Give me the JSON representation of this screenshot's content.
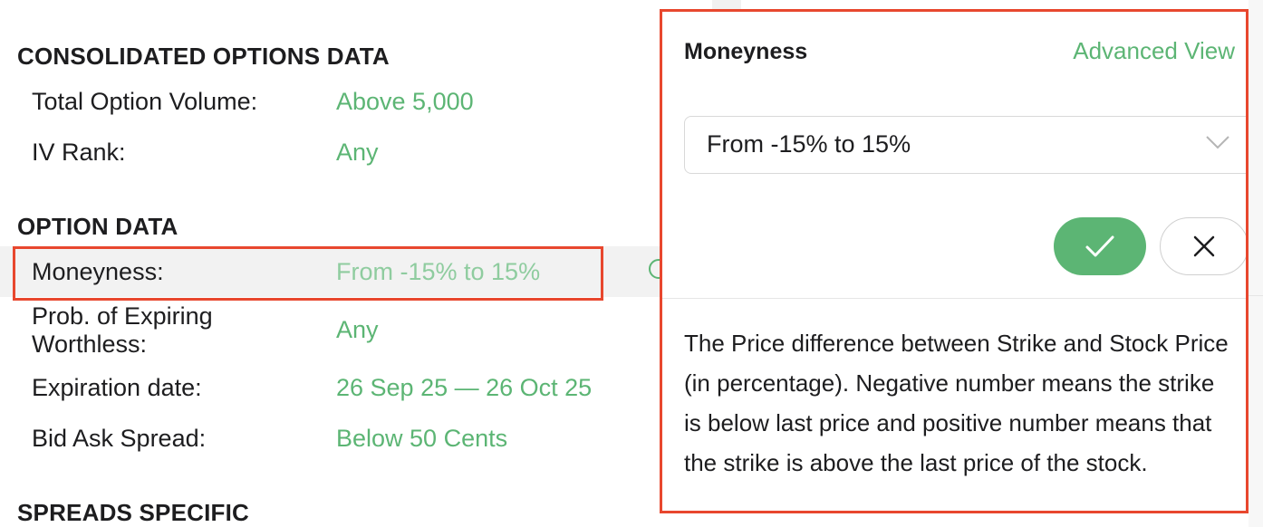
{
  "sections": {
    "consolidated": {
      "title": "CONSOLIDATED OPTIONS DATA",
      "rows": [
        {
          "label": "Total Option Volume:",
          "value": "Above 5,000"
        },
        {
          "label": "IV Rank:",
          "value": "Any"
        }
      ]
    },
    "option_data": {
      "title": "OPTION DATA",
      "rows": [
        {
          "label": "Moneyness:",
          "value": "From -15% to 15%"
        },
        {
          "label": "Prob. of Expiring Worthless:",
          "value": "Any"
        },
        {
          "label": "Expiration date:",
          "value": "26 Sep 25 — 26 Oct 25"
        },
        {
          "label": "Bid Ask Spread:",
          "value": "Below 50 Cents"
        }
      ]
    },
    "spreads": {
      "title": "SPREADS SPECIFIC"
    }
  },
  "popover": {
    "title": "Moneyness",
    "advanced_link": "Advanced View",
    "select_value": "From -15% to 15%",
    "description": "The Price difference between Strike and Stock Price (in percentage). Negative number means the strike is below last price and positive number means that the strike is above the last price of the stock."
  },
  "colors": {
    "accent_green": "#5cb574",
    "highlight_red": "#e8472e"
  },
  "icons": {
    "confirm": "checkmark-icon",
    "cancel": "close-icon",
    "dropdown": "chevron-down-icon"
  }
}
